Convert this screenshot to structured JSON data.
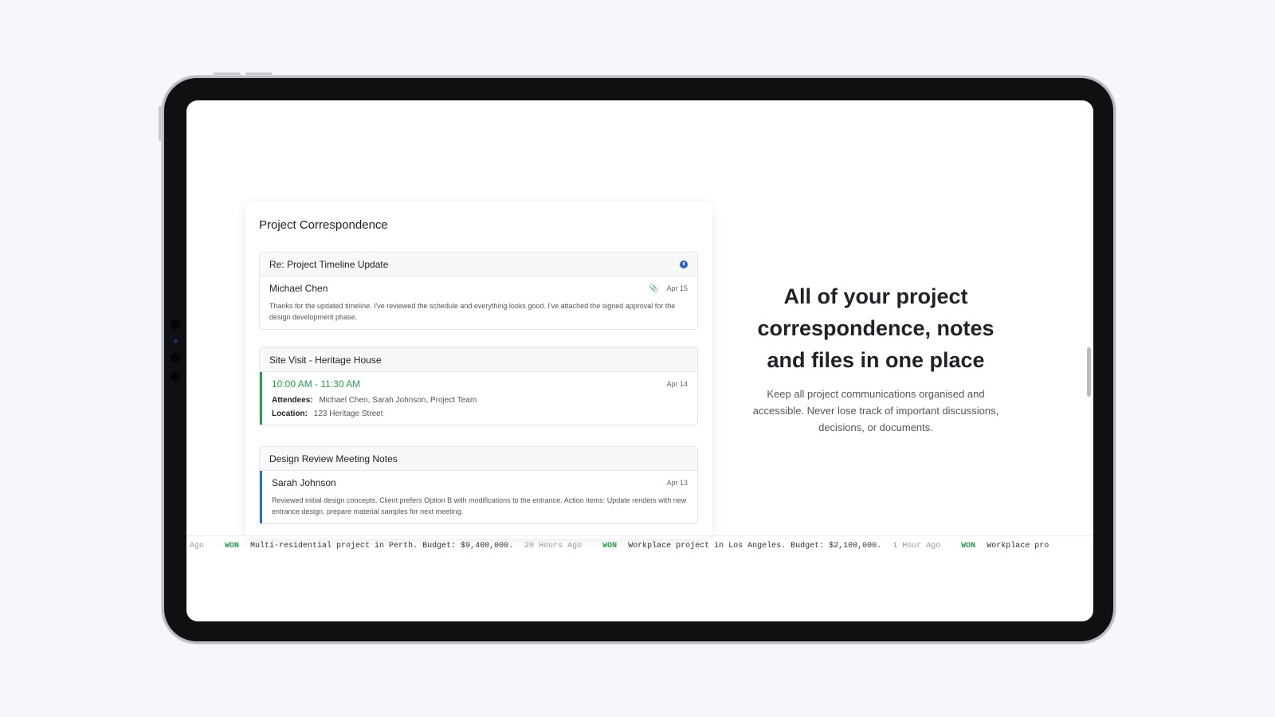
{
  "card": {
    "title": "Project Correspondence",
    "items": [
      {
        "subject": "Re: Project Timeline Update",
        "sender": "Michael Chen",
        "date": "Apr 15",
        "message": "Thanks for the updated timeline. I've reviewed the schedule and everything looks good. I've attached the signed approval for the design development phase.",
        "icon": "clock-icon",
        "attachment_icon": "paperclip-icon"
      },
      {
        "subject": "Site Visit - Heritage House",
        "time": "10:00 AM - 11:30 AM",
        "date": "Apr 14",
        "attendees_label": "Attendees:",
        "attendees": "Michael Chen, Sarah Johnson, Project Team",
        "location_label": "Location:",
        "location": "123 Heritage Street"
      },
      {
        "subject": "Design Review Meeting Notes",
        "sender": "Sarah Johnson",
        "date": "Apr 13",
        "message": "Reviewed initial design concepts. Client prefers Option B with modifications to the entrance. Action items: Update renders with new entrance design, prepare material samples for next meeting."
      }
    ]
  },
  "hero": {
    "title": "All of your project correspondence, notes and files in one place",
    "subtitle": "Keep all project communications organised and accessible. Never lose track of important discussions, decisions, or documents."
  },
  "ticker": {
    "lead_ago": "Ago",
    "entries": [
      {
        "status": "WON",
        "text": "Multi-residential project in Perth. Budget: $9,400,000.",
        "ago": "20 Hours Ago"
      },
      {
        "status": "WON",
        "text": "Workplace project in Los Angeles. Budget: $2,100,000.",
        "ago": "1 Hour Ago"
      },
      {
        "status": "WON",
        "text": "Workplace pro"
      }
    ]
  },
  "colors": {
    "accent_green": "#2e9a4f",
    "accent_blue": "#2f6ad0"
  }
}
